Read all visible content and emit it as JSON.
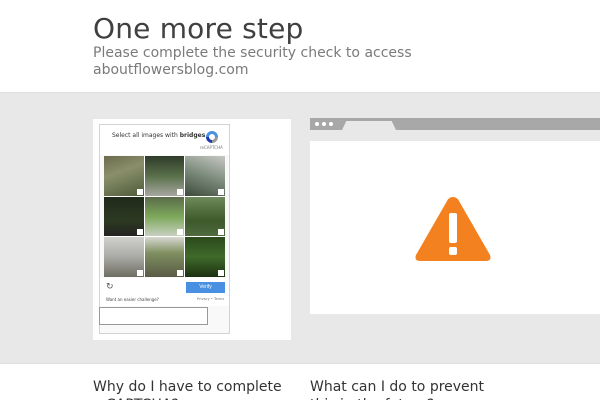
{
  "header": {
    "title": "One more step",
    "subtitle": "Please complete the security check to access aboutflowersblog.com"
  },
  "captcha": {
    "prompt_prefix": "Select all images with",
    "prompt_keyword": "bridges",
    "prompt_suffix": ".",
    "brand_text": "reCAPTCHA",
    "verify_label": "Verify",
    "easier_text": "Want an easier challenge?",
    "privacy_text": "Privacy • Terms",
    "reload_icon": "reload-icon",
    "tiles": [
      "tile-1",
      "tile-2",
      "tile-3",
      "tile-4",
      "tile-5",
      "tile-6",
      "tile-7",
      "tile-8",
      "tile-9"
    ],
    "answer_value": ""
  },
  "browser_illustration": {
    "icon": "warning-icon",
    "warning_color": "#f48120"
  },
  "faq": {
    "q1": "Why do I have to complete a CAPTCHA?",
    "q2": "What can I do to prevent this in the future?"
  }
}
